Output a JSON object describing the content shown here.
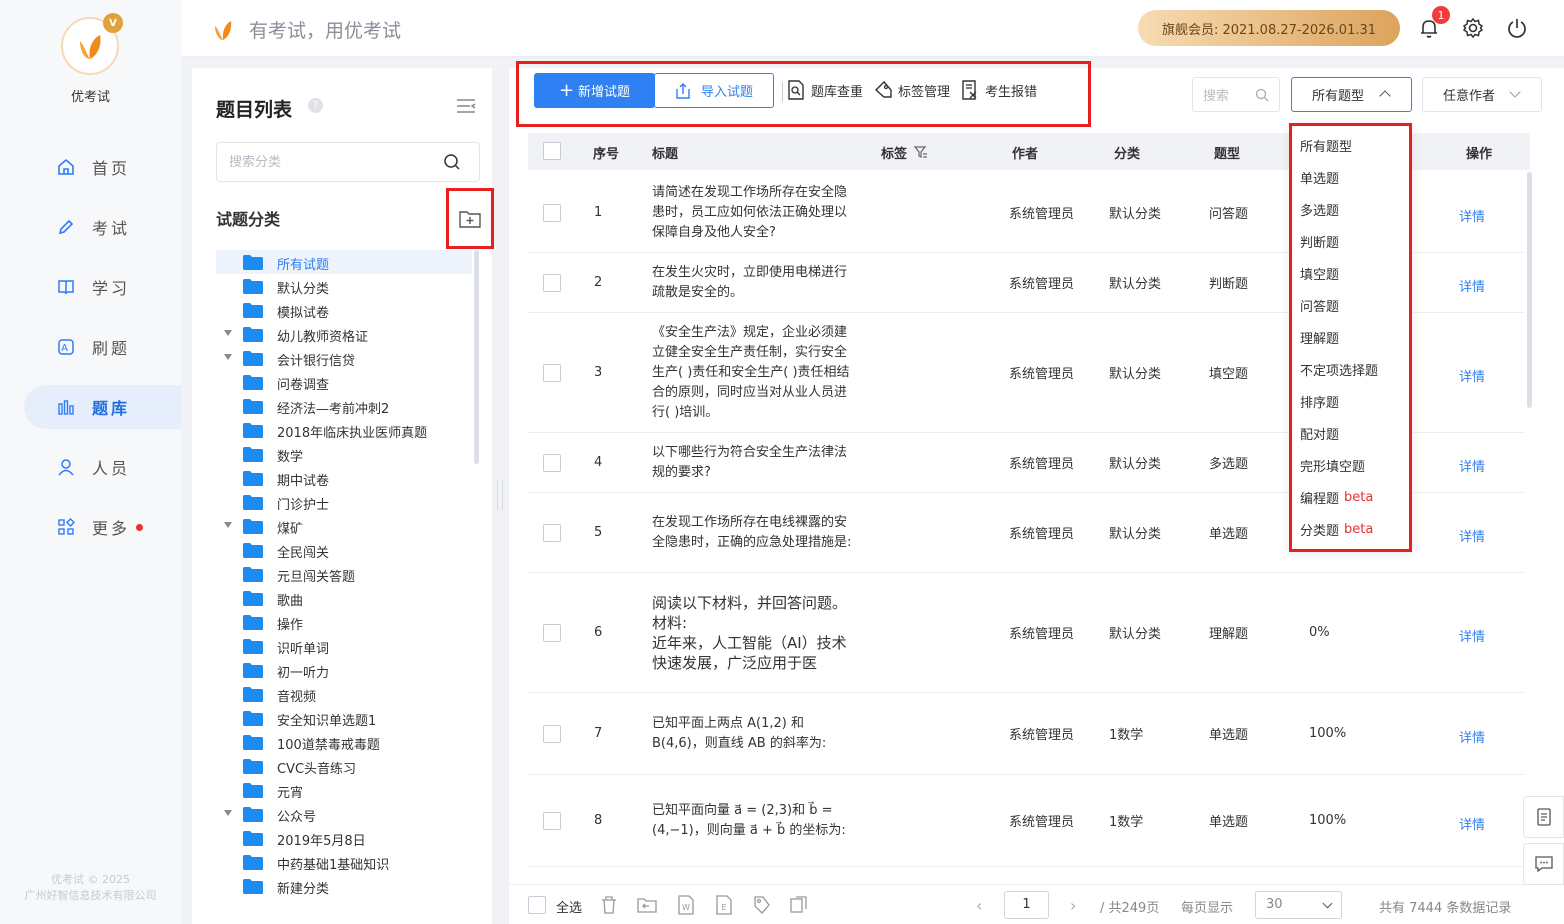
{
  "app": {
    "brand": "优考试",
    "slogan": "有考试，用优考试",
    "crown_letter": "V",
    "copyright_line1": "优考试 © 2025",
    "copyright_line2": "广州好智信息技术有限公司"
  },
  "header": {
    "vip_label": "旗舰会员: 2021.08.27-2026.01.31",
    "notification_count": "1"
  },
  "sidebar": {
    "items": [
      {
        "label": "首页",
        "icon": "home-icon",
        "active": false
      },
      {
        "label": "考试",
        "icon": "pencil-icon",
        "active": false
      },
      {
        "label": "学习",
        "icon": "book-icon",
        "active": false
      },
      {
        "label": "刷题",
        "icon": "quiz-icon",
        "active": false
      },
      {
        "label": "题库",
        "icon": "bar-chart-icon",
        "active": true
      },
      {
        "label": "人员",
        "icon": "user-icon",
        "active": false
      },
      {
        "label": "更多",
        "icon": "apps-icon",
        "active": false
      }
    ]
  },
  "category_panel": {
    "title": "题目列表",
    "help": "?",
    "search_placeholder": "搜索分类",
    "subtitle": "试题分类",
    "tree": [
      {
        "label": "所有试题",
        "expandable": false,
        "active": true
      },
      {
        "label": "默认分类",
        "expandable": false
      },
      {
        "label": "模拟试卷",
        "expandable": false
      },
      {
        "label": "幼儿教师资格证",
        "expandable": true
      },
      {
        "label": "会计银行信贷",
        "expandable": true
      },
      {
        "label": "问卷调查",
        "expandable": false
      },
      {
        "label": "经济法—考前冲刺2",
        "expandable": false
      },
      {
        "label": "2018年临床执业医师真题",
        "expandable": false
      },
      {
        "label": "数学",
        "expandable": false
      },
      {
        "label": "期中试卷",
        "expandable": false
      },
      {
        "label": "门诊护士",
        "expandable": false
      },
      {
        "label": "煤矿",
        "expandable": true
      },
      {
        "label": "全民闯关",
        "expandable": false
      },
      {
        "label": "元旦闯关答题",
        "expandable": false
      },
      {
        "label": "歌曲",
        "expandable": false
      },
      {
        "label": "操作",
        "expandable": false
      },
      {
        "label": "识听单词",
        "expandable": false
      },
      {
        "label": "初一听力",
        "expandable": false
      },
      {
        "label": "音视频",
        "expandable": false
      },
      {
        "label": "安全知识单选题1",
        "expandable": false
      },
      {
        "label": "100道禁毒戒毒题",
        "expandable": false
      },
      {
        "label": "CVC头音练习",
        "expandable": false
      },
      {
        "label": "元宵",
        "expandable": false
      },
      {
        "label": "公众号",
        "expandable": true
      },
      {
        "label": "2019年5月8日",
        "expandable": false
      },
      {
        "label": "中药基础1基础知识",
        "expandable": false
      },
      {
        "label": "新建分类",
        "expandable": false
      }
    ]
  },
  "toolbar": {
    "add_label": "新增试题",
    "import_label": "导入试题",
    "dedupe_label": "题库查重",
    "tags_label": "标签管理",
    "report_label": "考生报错",
    "search_placeholder": "搜索",
    "type_select": "所有题型",
    "author_select": "任意作者"
  },
  "table": {
    "headers": {
      "index": "序号",
      "title": "标题",
      "tags": "标签",
      "author": "作者",
      "category": "分类",
      "type": "题型",
      "op": "操作"
    },
    "rows": [
      {
        "index": "1",
        "title": "请简述在发现工作场所存在安全隐患时，员工应如何依法正确处理以保障自身及他人安全?",
        "author": "系统管理员",
        "category": "默认分类",
        "type": "问答题",
        "rate": "",
        "op": "详情"
      },
      {
        "index": "2",
        "title": "在发生火灾时，立即使用电梯进行疏散是安全的。",
        "author": "系统管理员",
        "category": "默认分类",
        "type": "判断题",
        "rate": "",
        "op": "详情"
      },
      {
        "index": "3",
        "title": "《安全生产法》规定，企业必须建立健全安全生产责任制，实行安全生产(  )责任和安全生产(  )责任相结合的原则，同时应当对从业人员进行(  )培训。",
        "author": "系统管理员",
        "category": "默认分类",
        "type": "填空题",
        "rate": "",
        "op": "详情"
      },
      {
        "index": "4",
        "title": "以下哪些行为符合安全生产法律法规的要求?",
        "author": "系统管理员",
        "category": "默认分类",
        "type": "多选题",
        "rate": "",
        "op": "详情"
      },
      {
        "index": "5",
        "title": "在发现工作场所存在电线裸露的安全隐患时，正确的应急处理措施是:",
        "author": "系统管理员",
        "category": "默认分类",
        "type": "单选题",
        "rate": "",
        "op": "详情"
      },
      {
        "index": "6",
        "title": "阅读以下材料，并回答问题。\n材料:\n近年来，人工智能（AI）技术快速发展，广泛应用于医",
        "author": "系统管理员",
        "category": "默认分类",
        "type": "理解题",
        "rate": "0%",
        "op": "详情"
      },
      {
        "index": "7",
        "title": "已知平面上两点 A(1,2) 和 B(4,6)，则直线 AB 的斜率为:",
        "author": "系统管理员",
        "category": "1数学",
        "type": "单选题",
        "rate": "100%",
        "op": "详情"
      },
      {
        "index": "8",
        "title": "已知平面向量 a⃗ = (2,3)和 b⃗ = (4,−1)，则向量 a⃗ + b⃗ 的坐标为:",
        "author": "系统管理员",
        "category": "1数学",
        "type": "单选题",
        "rate": "100%",
        "op": "详情"
      }
    ]
  },
  "type_dropdown": {
    "options": [
      {
        "label": "所有题型",
        "beta": ""
      },
      {
        "label": "单选题",
        "beta": ""
      },
      {
        "label": "多选题",
        "beta": ""
      },
      {
        "label": "判断题",
        "beta": ""
      },
      {
        "label": "填空题",
        "beta": ""
      },
      {
        "label": "问答题",
        "beta": ""
      },
      {
        "label": "理解题",
        "beta": ""
      },
      {
        "label": "不定项选择题",
        "beta": ""
      },
      {
        "label": "排序题",
        "beta": ""
      },
      {
        "label": "配对题",
        "beta": ""
      },
      {
        "label": "完形填空题",
        "beta": ""
      },
      {
        "label": "编程题",
        "beta": "beta"
      },
      {
        "label": "分类题",
        "beta": "beta"
      }
    ]
  },
  "footer": {
    "select_all": "全选",
    "current_page": "1",
    "total_pages": "/ 共249页",
    "per_page_label": "每页显示",
    "per_page_value": "30",
    "total_records": "共有 7444 条数据记录"
  },
  "colors": {
    "primary": "#2f80f3",
    "highlight_box": "#e5201f",
    "badge": "#f23c3c"
  }
}
